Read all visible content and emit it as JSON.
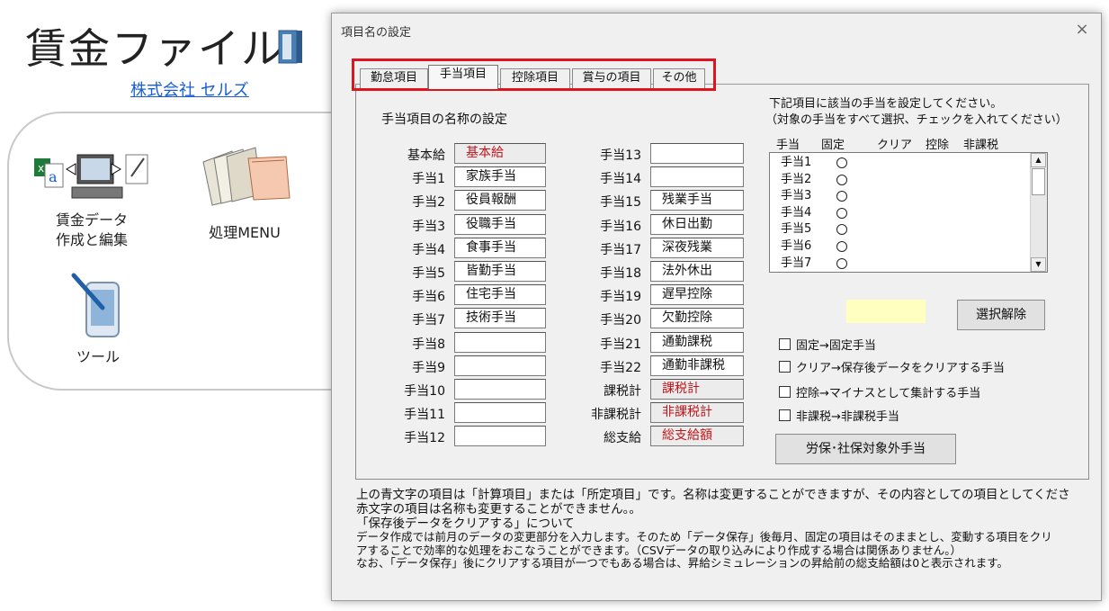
{
  "app": {
    "title": "賃金ファイル",
    "company": "株式会社 セルズ",
    "launchers": [
      {
        "label1": "賃金データ",
        "label2": "作成と編集"
      },
      {
        "label1": "処理MENU"
      },
      {
        "label1": "ツール"
      }
    ]
  },
  "dialog": {
    "title": "項目名の設定",
    "close": "×",
    "tabs": [
      "勤怠項目",
      "手当項目",
      "控除項目",
      "賞与の項目",
      "その他"
    ],
    "section_title": "手当項目の名称の設定",
    "left_column": [
      {
        "label": "基本給",
        "value": "基本給",
        "red": true
      },
      {
        "label": "手当1",
        "value": "家族手当"
      },
      {
        "label": "手当2",
        "value": "役員報酬"
      },
      {
        "label": "手当3",
        "value": "役職手当"
      },
      {
        "label": "手当4",
        "value": "食事手当"
      },
      {
        "label": "手当5",
        "value": "皆勤手当"
      },
      {
        "label": "手当6",
        "value": "住宅手当"
      },
      {
        "label": "手当7",
        "value": "技術手当"
      },
      {
        "label": "手当8",
        "value": ""
      },
      {
        "label": "手当9",
        "value": ""
      },
      {
        "label": "手当10",
        "value": ""
      },
      {
        "label": "手当11",
        "value": ""
      },
      {
        "label": "手当12",
        "value": ""
      }
    ],
    "right_column": [
      {
        "label": "手当13",
        "value": ""
      },
      {
        "label": "手当14",
        "value": ""
      },
      {
        "label": "手当15",
        "value": "残業手当"
      },
      {
        "label": "手当16",
        "value": "休日出勤"
      },
      {
        "label": "手当17",
        "value": "深夜残業"
      },
      {
        "label": "手当18",
        "value": "法外休出"
      },
      {
        "label": "手当19",
        "value": "遅早控除"
      },
      {
        "label": "手当20",
        "value": "欠勤控除"
      },
      {
        "label": "手当21",
        "value": "通勤課税"
      },
      {
        "label": "手当22",
        "value": "通勤非課税"
      },
      {
        "label": "課税計",
        "value": "課税計",
        "red": true
      },
      {
        "label": "非課税計",
        "value": "非課税計",
        "red": true
      },
      {
        "label": "総支給",
        "value": "総支給額",
        "red": true
      }
    ],
    "instruction1": "下記項目に該当の手当を設定してください。",
    "instruction2": "（対象の手当をすべて選択、チェックを入れてください）",
    "list_headers": [
      "手当",
      "固定",
      "クリア",
      "控除",
      "非課税"
    ],
    "list_rows": [
      "手当1",
      "手当2",
      "手当3",
      "手当4",
      "手当5",
      "手当6",
      "手当7"
    ],
    "deselect_button": "選択解除",
    "legend": [
      "固定→固定手当",
      "クリア→保存後データをクリアする手当",
      "控除→マイナスとして集計する手当",
      "非課税→非課税手当"
    ],
    "exclude_button": "労保･社保対象外手当",
    "notes": [
      "上の青文字の項目は「計算項目」または「所定項目」です。名称は変更することができますが、その内容としての項目としてくださ",
      "赤文字の項目は名称も変更することができません。。",
      "「保存後データをクリアする」について",
      "データ作成では前月のデータの変更部分を入力します。そのため「データ保存」後毎月、固定の項目はそのままとし、変動する項目をクリ",
      "アすることで効率的な処理をおこなうことができます。（CSVデータの取り込みにより作成する場合は関係ありません。）",
      "なお、「データ保存」後にクリアする項目が一つでもある場合は、昇給シミュレーションの昇給前の総支給額は0と表示されます。"
    ],
    "colors": {
      "highlight": "#e0141e",
      "red_text": "#c0151a",
      "link": "#1a5fd0",
      "swatch": "#ffffc0"
    }
  }
}
